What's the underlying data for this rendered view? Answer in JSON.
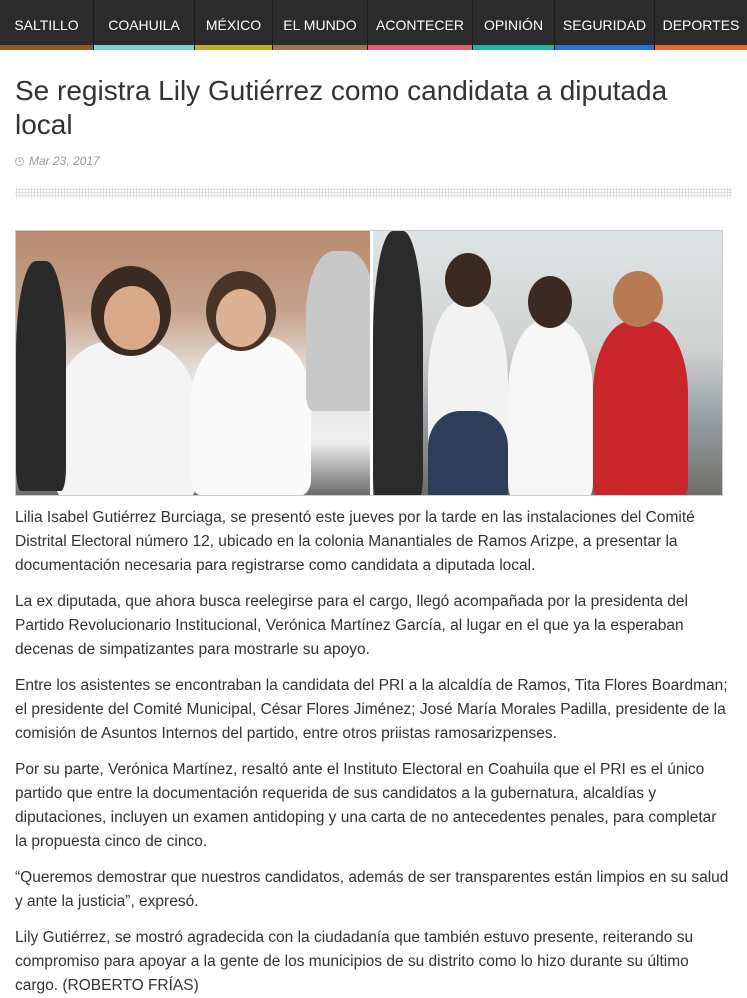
{
  "nav": {
    "items": [
      {
        "label": "SALTILLO",
        "color": "#8a5a2b"
      },
      {
        "label": "COAHUILA",
        "color": "#7fd3c8"
      },
      {
        "label": "MÉXICO",
        "color": "#b8b22a"
      },
      {
        "label": "EL MUNDO",
        "color": "#a0735a"
      },
      {
        "label": "ACONTECER",
        "color": "#e85a7a"
      },
      {
        "label": "OPINIÓN",
        "color": "#1fb5a5"
      },
      {
        "label": "SEGURIDAD",
        "color": "#2f6fd6"
      },
      {
        "label": "DEPORTES",
        "color": "#e8662a"
      }
    ]
  },
  "article": {
    "title": "Se registra Lily Gutiérrez como candidata a diputada local",
    "date": "Mar 23, 2017",
    "date_icon": "clock-icon",
    "paragraphs": [
      "Lilia Isabel Gutiérrez Burciaga, se presentó este jueves por la tarde en las instalaciones del Comité Distrital Electoral número 12, ubicado en la colonia Manantiales de Ramos Arizpe, a presentar la documentación necesaria para registrarse como candidata a diputada local.",
      "La ex diputada, que ahora busca reelegirse para el cargo, llegó acompañada por la presidenta del Partido Revolucionario Institucional, Verónica Martínez García, al lugar en el que ya la esperaban decenas de simpatizantes para mostrarle su apoyo.",
      "Entre los asistentes se encontraban la candidata del PRI a la alcaldía de Ramos, Tita Flores Boardman; el presidente del Comité Municipal, César Flores Jiménez; José María Morales Padilla, presidente de la comisión de Asuntos Internos del partido, entre otros priistas ramosarizpenses.",
      "Por su parte, Verónica Martínez, resaltó ante el Instituto Electoral en Coahuila que el PRI es el único partido que entre la documentación requerida de sus candidatos a la gubernatura, alcaldías y diputaciones, incluyen un examen antidoping y una carta de no antecedentes penales, para completar la propuesta cinco de cinco.",
      "“Queremos demostrar que nuestros candidatos, además de ser transparentes están limpios en su salud y ante la justicia”, expresó.",
      "Lily Gutiérrez, se mostró agradecida con la ciudadanía que también estuvo presente, reiterando su compromiso para apoyar a la gente de los municipios de su distrito como lo hizo durante su último cargo. (ROBERTO FRÍAS)"
    ]
  }
}
